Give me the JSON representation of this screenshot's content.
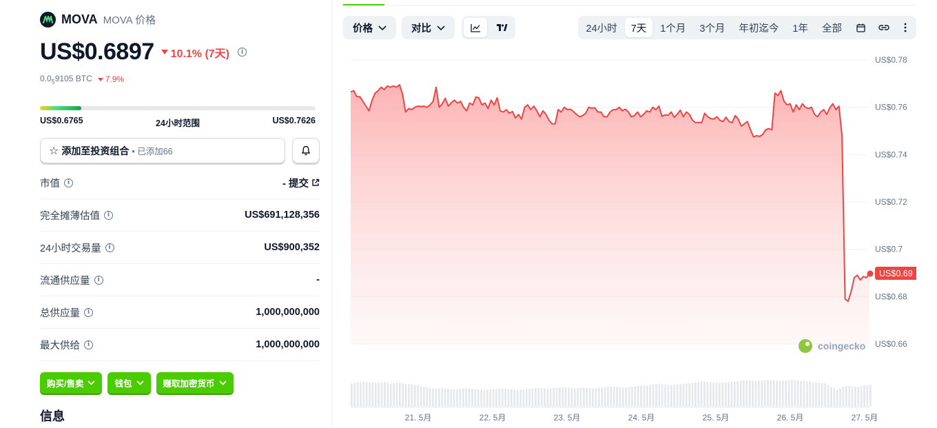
{
  "coin": {
    "name": "MOVA",
    "subtitle": "MOVA 价格",
    "price": "US$0.6897",
    "change_7d": "10.1% (7天)",
    "btc_price_prefix": "0.0",
    "btc_price_sub": "5",
    "btc_price_suffix": "9105 BTC",
    "btc_change": "7.9%"
  },
  "range_24h": {
    "low": "US$0.6765",
    "label": "24小时范围",
    "high": "US$0.7626",
    "fill_fraction": 0.15
  },
  "portfolio": {
    "label": "添加至投资组合",
    "added": "• 已添加66"
  },
  "stats": [
    {
      "label": "市值",
      "value": "- 提交",
      "link": true
    },
    {
      "label": "完全摊薄估值",
      "value": "US$691,128,356"
    },
    {
      "label": "24小时交易量",
      "value": "US$900,352"
    },
    {
      "label": "流通供应量",
      "value": "-"
    },
    {
      "label": "总供应量",
      "value": "1,000,000,000"
    },
    {
      "label": "最大供给",
      "value": "1,000,000,000"
    }
  ],
  "actions": {
    "buy_sell": "购买/售卖",
    "wallet": "钱包",
    "earn": "赚取加密货币"
  },
  "info_title": "信息",
  "controls": {
    "price_dd": "价格",
    "compare_dd": "对比",
    "periods": [
      "24小时",
      "7天",
      "1个月",
      "3个月",
      "年初迄今",
      "1年",
      "全部"
    ],
    "active_period": "7天"
  },
  "colors": {
    "accent_green": "#4bcc00",
    "down_red": "#ef4444"
  },
  "chart_data": {
    "type": "area",
    "y_ticks": [
      "US$0.78",
      "US$0.76",
      "US$0.74",
      "US$0.72",
      "US$0.7",
      "US$0.68",
      "US$0.66"
    ],
    "ylim": [
      0.66,
      0.78
    ],
    "x_ticks": [
      "21. 5月",
      "22. 5月",
      "23. 5月",
      "24. 5月",
      "25. 5月",
      "26. 5月",
      "27. 5月"
    ],
    "current_label": "US$0.69",
    "watermark": "coingecko",
    "values": [
      0.7665,
      0.767,
      0.7645,
      0.7645,
      0.7625,
      0.7605,
      0.7585,
      0.763,
      0.766,
      0.767,
      0.7685,
      0.7675,
      0.769,
      0.7685,
      0.769,
      0.7685,
      0.7695,
      0.7655,
      0.758,
      0.7595,
      0.759,
      0.76,
      0.7605,
      0.7603,
      0.7605,
      0.76,
      0.761,
      0.7625,
      0.7685,
      0.76,
      0.7615,
      0.7638,
      0.7605,
      0.762,
      0.763,
      0.7618,
      0.7625,
      0.76,
      0.7585,
      0.7618,
      0.761,
      0.7643,
      0.764,
      0.761,
      0.7618,
      0.7595,
      0.763,
      0.761,
      0.764,
      0.7585,
      0.758,
      0.759,
      0.7575,
      0.7582,
      0.7555,
      0.757,
      0.755,
      0.76,
      0.761,
      0.759,
      0.7605,
      0.7585,
      0.756,
      0.7585,
      0.757,
      0.7545,
      0.753,
      0.753,
      0.759,
      0.758,
      0.76,
      0.759,
      0.7592,
      0.7582,
      0.757,
      0.756,
      0.7565,
      0.7575,
      0.76,
      0.7596,
      0.7598,
      0.758,
      0.758,
      0.756,
      0.756,
      0.758,
      0.759,
      0.759,
      0.76,
      0.7585,
      0.7592,
      0.758,
      0.756,
      0.7565,
      0.758,
      0.756,
      0.757,
      0.7585,
      0.758,
      0.76,
      0.759,
      0.7605,
      0.7562,
      0.7568,
      0.7566,
      0.758,
      0.7558,
      0.757,
      0.7588,
      0.756,
      0.758,
      0.757,
      0.7545,
      0.7535,
      0.7536,
      0.7535,
      0.7575,
      0.756,
      0.7552,
      0.755,
      0.756,
      0.7545,
      0.754,
      0.7558,
      0.754,
      0.7535,
      0.7565,
      0.755,
      0.752,
      0.753,
      0.754,
      0.7505,
      0.7475,
      0.748,
      0.7477,
      0.7485,
      0.7505,
      0.751,
      0.7505,
      0.766,
      0.765,
      0.767,
      0.7625,
      0.761,
      0.7615,
      0.758,
      0.761,
      0.759,
      0.7615,
      0.76,
      0.7595,
      0.76,
      0.757,
      0.756,
      0.758,
      0.759,
      0.757,
      0.7598,
      0.7615,
      0.759,
      0.7605,
      0.748,
      0.679,
      0.678,
      0.6822,
      0.688,
      0.689,
      0.687,
      0.6885,
      0.688,
      0.6897
    ],
    "volume": [
      0.7,
      0.72,
      0.74,
      0.73,
      0.75,
      0.74,
      0.73,
      0.72,
      0.71,
      0.72,
      0.73,
      0.74,
      0.72,
      0.7,
      0.71,
      0.72,
      0.73,
      0.7,
      0.69,
      0.68,
      0.67,
      0.66,
      0.64,
      0.62,
      0.6,
      0.58,
      0.56,
      0.55,
      0.54,
      0.55,
      0.56,
      0.55,
      0.54,
      0.53,
      0.52,
      0.53,
      0.54,
      0.55,
      0.56,
      0.55,
      0.54,
      0.53,
      0.52,
      0.51,
      0.5,
      0.51,
      0.52,
      0.53,
      0.54,
      0.55,
      0.55,
      0.54,
      0.53,
      0.52,
      0.51,
      0.5,
      0.51,
      0.52,
      0.53,
      0.54,
      0.55,
      0.56,
      0.57,
      0.56,
      0.55,
      0.54,
      0.55,
      0.56,
      0.57,
      0.58,
      0.59,
      0.58,
      0.57,
      0.56,
      0.55,
      0.56,
      0.57,
      0.58,
      0.57,
      0.56,
      0.55,
      0.56,
      0.57,
      0.58,
      0.59,
      0.6,
      0.61,
      0.6,
      0.59,
      0.58,
      0.57,
      0.58,
      0.59,
      0.6,
      0.61,
      0.62,
      0.63,
      0.64,
      0.65,
      0.66,
      0.67,
      0.68,
      0.69,
      0.68,
      0.67,
      0.66,
      0.65,
      0.66,
      0.67,
      0.68,
      0.69,
      0.7,
      0.71,
      0.72,
      0.73,
      0.74,
      0.75,
      0.76,
      0.75,
      0.74,
      0.73,
      0.72,
      0.71,
      0.72,
      0.73,
      0.74,
      0.75,
      0.76,
      0.77,
      0.78,
      0.79,
      0.8,
      0.79,
      0.78,
      0.77,
      0.78,
      0.79,
      0.8,
      0.81,
      0.8,
      0.79,
      0.78,
      0.77,
      0.78,
      0.79,
      0.8,
      0.81,
      0.8,
      0.79,
      0.78,
      0.77,
      0.76,
      0.75,
      0.74,
      0.73,
      0.72,
      0.71,
      0.7,
      0.65,
      0.6,
      0.55,
      0.5,
      0.55,
      0.6,
      0.62,
      0.63,
      0.62,
      0.61,
      0.6,
      0.62,
      0.64,
      0.65,
      0.66
    ]
  }
}
